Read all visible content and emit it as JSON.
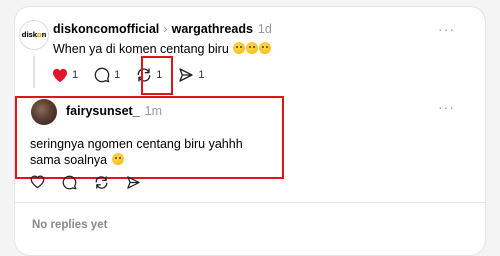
{
  "post": {
    "username": "diskoncomofficial",
    "breadcrumb_separator": "›",
    "community": "wargathreads",
    "time": "1d",
    "text": "When ya di komen centang biru",
    "emoji_count_label": "🥹🥹🥹",
    "avatar_logo_text": "diskon",
    "likes": "1",
    "replies": "1",
    "reposts": "1",
    "shares": "1",
    "more_label": "···"
  },
  "reply": {
    "username": "fairysunset_",
    "time": "1m",
    "line1": "seringnya ngomen centang biru yahhh",
    "line2": "sama soalnya",
    "more_label": "···"
  },
  "footer": {
    "no_replies": "No replies yet"
  },
  "colors": {
    "like_active": "#e0152f",
    "highlight": "#e0151a",
    "muted_text": "#999999"
  },
  "icons": {
    "like": "heart-icon",
    "reply": "comment-icon",
    "repost": "repost-icon",
    "share": "send-icon"
  }
}
